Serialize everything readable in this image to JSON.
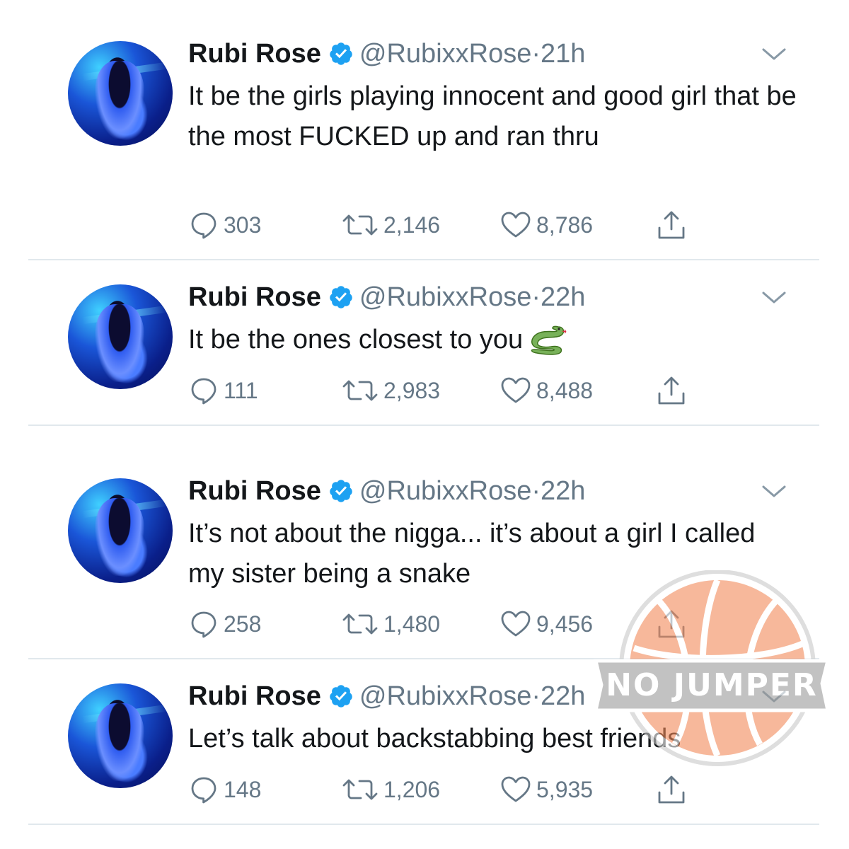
{
  "tweets": [
    {
      "name": "Rubi Rose",
      "handle": "@RubixxRose",
      "dot": "·",
      "time": "21h",
      "text": "It be the girls playing innocent and good girl that be the most FUCKED up and ran thru",
      "emoji": "",
      "replies": "303",
      "retweets": "2,146",
      "likes": "8,786"
    },
    {
      "name": "Rubi Rose",
      "handle": "@RubixxRose",
      "dot": "·",
      "time": "22h",
      "text": "It be the ones closest to you",
      "emoji": "snake-emoji",
      "replies": "111",
      "retweets": "2,983",
      "likes": "8,488"
    },
    {
      "name": "Rubi Rose",
      "handle": "@RubixxRose",
      "dot": "·",
      "time": "22h",
      "text": "It’s not about the nigga... it’s about a girl I called my sister being a snake",
      "emoji": "",
      "replies": "258",
      "retweets": "1,480",
      "likes": "9,456"
    },
    {
      "name": "Rubi Rose",
      "handle": "@RubixxRose",
      "dot": "·",
      "time": "22h",
      "text": "Let’s talk about backstabbing best friends",
      "emoji": "",
      "replies": "148",
      "retweets": "1,206",
      "likes": "5,935"
    }
  ],
  "watermark": {
    "text": "NO JUMPER"
  },
  "colors": {
    "verified": "#1da1f2",
    "secondary_text": "#657786",
    "divider": "#e1e8ed",
    "watermark_ball": "#f28a5a"
  }
}
